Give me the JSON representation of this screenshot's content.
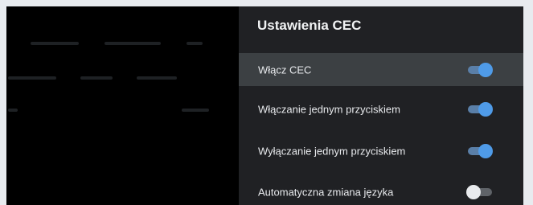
{
  "panel": {
    "title": "Ustawienia CEC",
    "items": [
      {
        "label": "Włącz CEC",
        "state": "on",
        "focused": true
      },
      {
        "label": "Włączanie jednym przyciskiem",
        "state": "on",
        "focused": false
      },
      {
        "label": "Wyłączanie jednym przyciskiem",
        "state": "on",
        "focused": false
      },
      {
        "label": "Automatyczna zmiana języka",
        "state": "off",
        "focused": false
      }
    ]
  },
  "colors": {
    "panel_bg": "#202124",
    "focus_bg": "#3c4043",
    "toggle_on": "#4f9be8",
    "toggle_off": "#e8eaed"
  }
}
